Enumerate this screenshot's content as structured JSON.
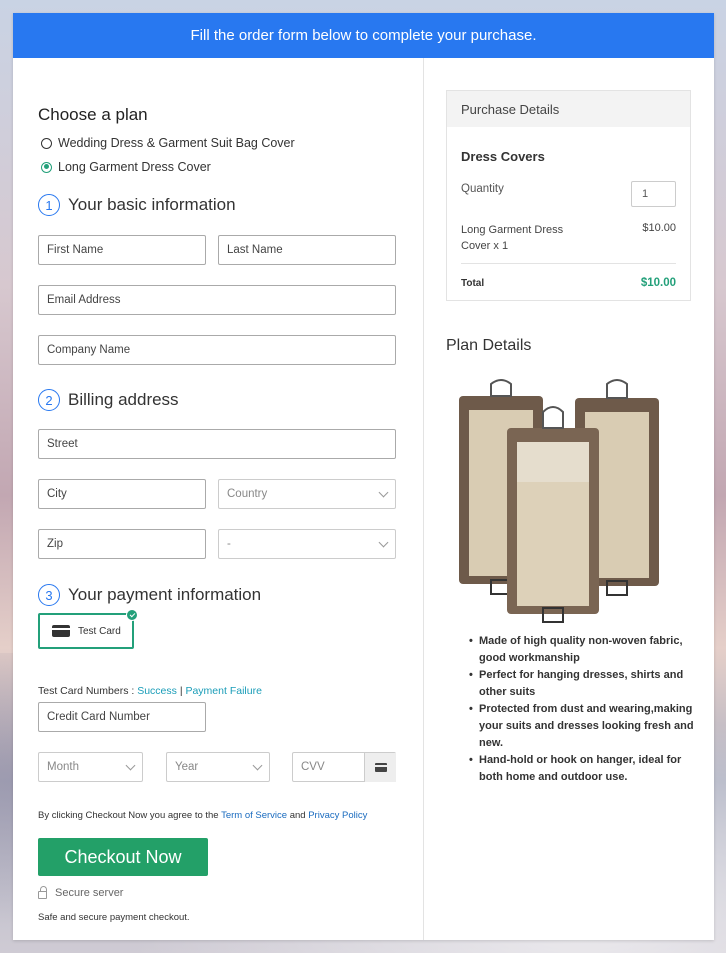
{
  "banner": "Fill the order form below to complete your purchase.",
  "plan": {
    "heading": "Choose a plan",
    "options": [
      "Wedding Dress & Garment Suit Bag Cover",
      "Long Garment Dress Cover"
    ],
    "selected_index": 1
  },
  "basic": {
    "number": "1",
    "title": "Your basic information",
    "first_name": "First Name",
    "last_name": "Last Name",
    "email": "Email Address",
    "company": "Company Name"
  },
  "billing": {
    "number": "2",
    "title": "Billing address",
    "street": "Street",
    "city": "City",
    "country": "Country",
    "zip": "Zip",
    "state": "-"
  },
  "payment": {
    "number": "3",
    "title": "Your payment information",
    "test_card": "Test Card",
    "test_numbers_label": "Test Card Numbers :",
    "success": "Success",
    "separator": "|",
    "failure": "Payment Failure",
    "card_number": "Credit Card Number",
    "month": "Month",
    "year": "Year",
    "cvv": "CVV"
  },
  "agreement": {
    "prefix": "By clicking Checkout Now you agree to the",
    "terms": "Term of Service",
    "and": "and",
    "privacy": "Privacy Policy"
  },
  "checkout_button": "Checkout Now",
  "secure_server": "Secure server",
  "safe_text": "Safe and secure payment checkout.",
  "purchase": {
    "header": "Purchase Details",
    "product": "Dress Covers",
    "quantity_label": "Quantity",
    "quantity_value": "1",
    "item_name": "Long Garment Dress Cover x 1",
    "item_price": "$10.00",
    "total_label": "Total",
    "total_value": "$10.00"
  },
  "plan_details": {
    "title": "Plan Details",
    "bullets": [
      "Made of high quality non-woven fabric, good workmanship",
      "Perfect for hanging dresses, shirts and other suits",
      "Protected from dust and wearing,making your suits and dresses looking fresh and new.",
      "Hand-hold or hook on hanger, ideal for both home and outdoor use."
    ]
  },
  "colors": {
    "banner": "#2878f0",
    "accent_green": "#23a068",
    "link": "#1a9db8"
  }
}
